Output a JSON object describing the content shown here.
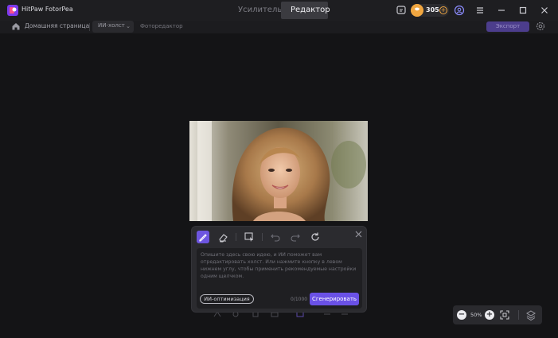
{
  "app": {
    "title": "HitPaw FotorPea"
  },
  "mode_tabs": [
    {
      "label": "Усилитель",
      "active": false
    },
    {
      "label": "Редактор",
      "active": true
    }
  ],
  "credits": {
    "count": "305",
    "plus": "+"
  },
  "window_icons": [
    "feedback-icon",
    "account-icon",
    "menu-icon",
    "minimize-icon",
    "maximize-icon",
    "close-icon"
  ],
  "nav": {
    "home_label": "Домашняя страница",
    "mode_select": "ИИ-холст",
    "mode_caret": "⌄",
    "breadcrumb": "Фоторедактор",
    "export_label": "Экспорт"
  },
  "panel": {
    "tools": [
      "brush-icon",
      "eraser-icon",
      "select-icon",
      "undo-icon",
      "redo-icon",
      "reset-icon"
    ],
    "active_tool": "brush-icon",
    "placeholder": "Опишите здесь свою идею, и ИИ поможет вам отредактировать холст. Или нажмите кнопку в левом нижнем углу, чтобы применить рекомендуемые настройки одним щелчком.",
    "ai_optimize_label": "ИИ-оптимизация",
    "char_count": "0/1000",
    "generate_label": "Сгенерировать"
  },
  "zoom": {
    "minus": "−",
    "value": "50%",
    "plus": "+"
  },
  "colors": {
    "accent": "#6a51e6",
    "coin": "#f0a640",
    "background": "#141416"
  }
}
